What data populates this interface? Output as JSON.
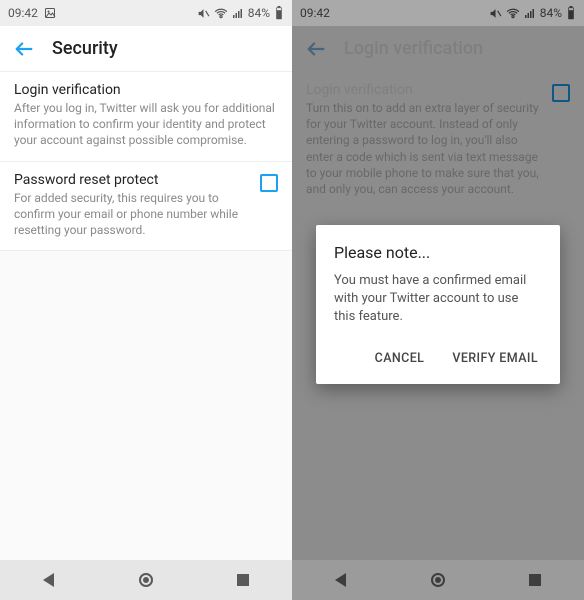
{
  "status": {
    "time": "09:42",
    "battery_pct": "84%"
  },
  "left": {
    "header_title": "Security",
    "login_verification": {
      "title": "Login verification",
      "desc": "After you log in, Twitter will ask you for additional information to confirm your identity and protect your account against possible compromise."
    },
    "password_reset": {
      "title": "Password reset protect",
      "desc": "For added security, this requires you to confirm your email or phone number while resetting your password."
    }
  },
  "right": {
    "header_title": "Login verification",
    "login_verification": {
      "title": "Login verification",
      "desc": "Turn this on to add an extra layer of security for your Twitter account. Instead of only entering a password to log in, you'll also enter a code which is sent via text message to your mobile phone to make sure that you, and only you, can access your account."
    },
    "dialog": {
      "title": "Please note...",
      "body": "You must have a confirmed email with your Twitter account to use this feature.",
      "cancel": "CANCEL",
      "confirm": "VERIFY EMAIL"
    }
  }
}
